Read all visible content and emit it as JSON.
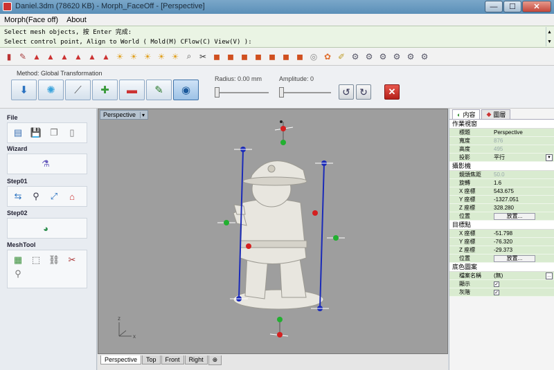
{
  "window": {
    "title": "Daniel.3dm (78620 KB) - Morph_FaceOff - [Perspective]",
    "min_glyph": "—",
    "max_glyph": "☐",
    "close_glyph": "✕"
  },
  "menu": [
    "Morph(Face off)",
    "About"
  ],
  "command": {
    "line1": "Select mesh objects, 按 Enter 完成:",
    "line2": "Select control point, Align to World ( Mold(M)  CFlow(C)  View(V) ):"
  },
  "toolbar_icons": [
    "file-icon",
    "brush-icon",
    "render-icon",
    "render-icon",
    "render-icon",
    "render-icon",
    "render-icon",
    "render-icon",
    "light-icon",
    "light-icon",
    "light-icon",
    "light-icon",
    "light-icon",
    "zoom-icon",
    "cut-icon",
    "paint-icon",
    "paint-icon",
    "paint-icon",
    "paint-icon",
    "paint-icon",
    "paint-icon",
    "paint-icon",
    "target-icon",
    "color-icon",
    "pen-icon",
    "tool-icon",
    "tool-icon",
    "tool-icon",
    "tool-icon",
    "tool-icon",
    "tool-icon"
  ],
  "morph": {
    "method_label": "Method: Global Transformation",
    "radius_label": "Radius: 0.00 mm",
    "amplitude_label": "Amplitude: 0",
    "radius_value": 0,
    "amplitude_value": 0
  },
  "left": {
    "sections": [
      {
        "title": "File",
        "icons": [
          "open-icon",
          "save-icon",
          "copy-icon",
          "page-icon"
        ]
      },
      {
        "title": "Wizard",
        "icons": [
          "wizard-icon"
        ]
      },
      {
        "title": "Step01",
        "icons": [
          "align-icon",
          "pin-icon",
          "scale-icon",
          "house-icon"
        ]
      },
      {
        "title": "Step02",
        "icons": [
          "morph-icon"
        ]
      },
      {
        "title": "MeshTool",
        "icons": [
          "mesh-icon",
          "select-icon",
          "weld-icon",
          "repair-icon",
          "brush-icon"
        ]
      }
    ]
  },
  "viewport": {
    "title": "Perspective",
    "tabs": [
      "Perspective",
      "Top",
      "Front",
      "Right"
    ],
    "add_tab": "⊕",
    "axis_x": "x",
    "axis_z": "z"
  },
  "right": {
    "tabs": [
      "内容",
      "圖層"
    ],
    "sections": [
      {
        "header": "作業視窗",
        "rows": [
          {
            "k": "標題",
            "v": "Perspective"
          },
          {
            "k": "寬度",
            "v": "876",
            "dim": true
          },
          {
            "k": "高度",
            "v": "495",
            "dim": true
          },
          {
            "k": "投影",
            "v": "平行",
            "dropdown": true
          }
        ]
      },
      {
        "header": "攝影機",
        "rows": [
          {
            "k": "鏡頭焦距",
            "v": "50.0",
            "dim": true
          },
          {
            "k": "旋轉",
            "v": "1.6"
          },
          {
            "k": "X 座標",
            "v": "543.675"
          },
          {
            "k": "Y 座標",
            "v": "-1327.051"
          },
          {
            "k": "Z 座標",
            "v": "328.280"
          },
          {
            "k": "位置",
            "button": "放置..."
          }
        ]
      },
      {
        "header": "目標點",
        "rows": [
          {
            "k": "X 座標",
            "v": "-51.798"
          },
          {
            "k": "Y 座標",
            "v": "-76.320"
          },
          {
            "k": "Z 座標",
            "v": "-29.373"
          },
          {
            "k": "位置",
            "button": "放置..."
          }
        ]
      },
      {
        "header": "底色圖案",
        "rows": [
          {
            "k": "檔案名稱",
            "v": "(無)",
            "more": true
          },
          {
            "k": "顯示",
            "check": true
          },
          {
            "k": "灰階",
            "check": true
          }
        ]
      }
    ]
  }
}
